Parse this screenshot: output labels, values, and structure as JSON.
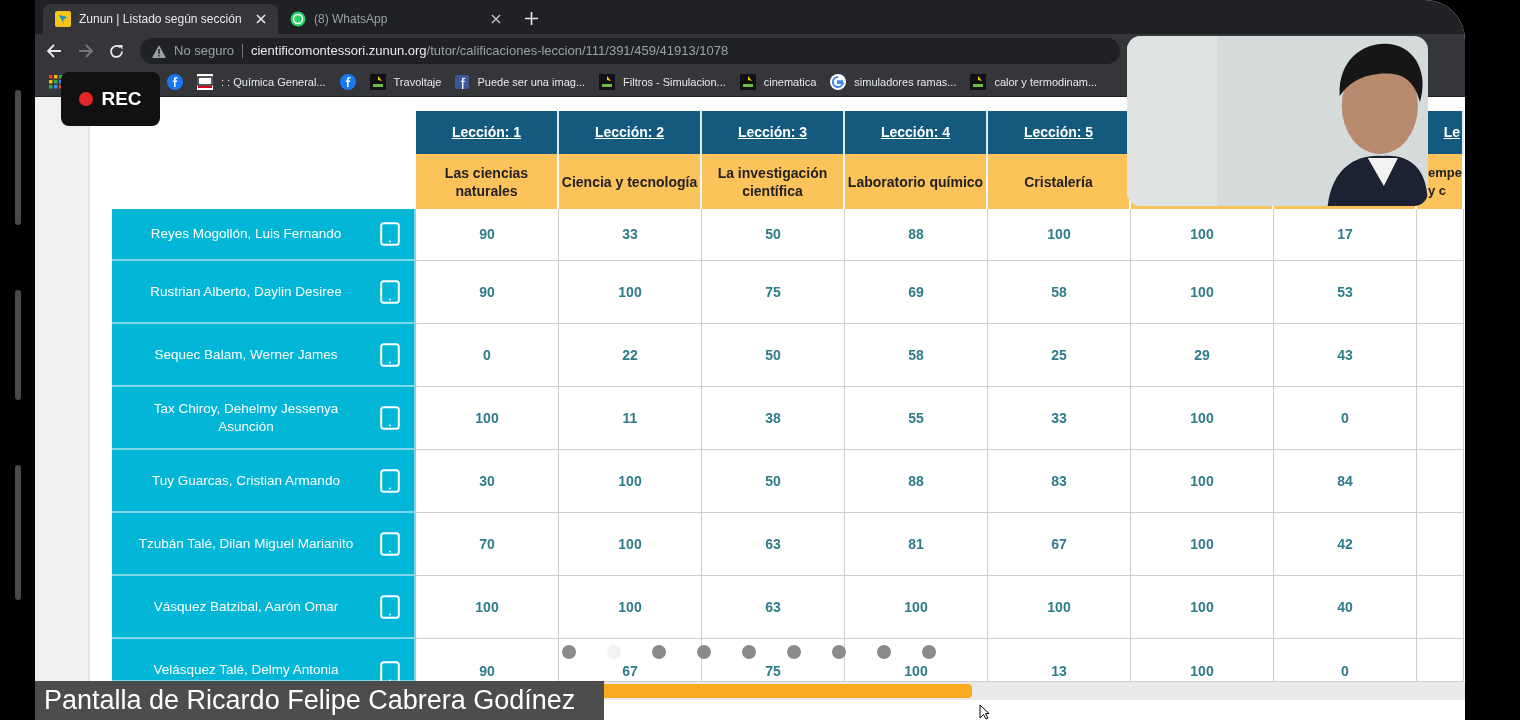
{
  "browser": {
    "tabs": [
      {
        "title": "Zunun | Listado según sección",
        "selected": true,
        "kind": "zunun"
      },
      {
        "title": "(8) WhatsApp",
        "selected": false,
        "kind": "whatsapp"
      }
    ],
    "security": "No seguro",
    "url_domain": "cientificomontessori.zunun.org",
    "url_path": "/tutor/calificaciones-leccion/111/391/459/41913/1078",
    "bookmarks": [
      {
        "kind": "apps"
      },
      {
        "kind": "facebook"
      },
      {
        "kind": "cg",
        "label": ": : Química General..."
      },
      {
        "kind": "facebook"
      },
      {
        "kind": "phet",
        "label": "Travoltaje"
      },
      {
        "kind": "fbsquare",
        "label": "Puede ser una imag..."
      },
      {
        "kind": "phet",
        "label": "Filtros - Simulacion..."
      },
      {
        "kind": "phet",
        "label": "cinematica"
      },
      {
        "kind": "google",
        "label": "simuladores ramas..."
      },
      {
        "kind": "phet",
        "label": "calor y termodinam..."
      }
    ]
  },
  "recording": {
    "label": "REC"
  },
  "table": {
    "columns": [
      {
        "lesson": "Lección: 1",
        "title": "Las ciencias naturales"
      },
      {
        "lesson": "Lección: 2",
        "title": "Ciencia y tecnología"
      },
      {
        "lesson": "Lección: 3",
        "title": "La investigación científica"
      },
      {
        "lesson": "Lección: 4",
        "title": "Laboratorio químico"
      },
      {
        "lesson": "Lección: 5",
        "title": "Cristalería"
      },
      {},
      {},
      {
        "lesson": "Le",
        "title": "empe\ny c"
      }
    ],
    "rows": [
      {
        "name": "Reyes Mogollón, Luis Fernando",
        "scores": [
          "90",
          "33",
          "50",
          "88",
          "100",
          "100",
          "17"
        ]
      },
      {
        "name": "Rustrian Alberto, Daylin Desiree",
        "scores": [
          "90",
          "100",
          "75",
          "69",
          "58",
          "100",
          "53"
        ]
      },
      {
        "name": "Sequec Balam, Werner James",
        "scores": [
          "0",
          "22",
          "50",
          "58",
          "25",
          "29",
          "43"
        ]
      },
      {
        "name": "Tax Chiroy, Dehelmy Jessenya Asunción",
        "scores": [
          "100",
          "11",
          "38",
          "55",
          "33",
          "100",
          "0"
        ]
      },
      {
        "name": "Tuy Guarcas, Cristian Armando",
        "scores": [
          "30",
          "100",
          "50",
          "88",
          "83",
          "100",
          "84"
        ]
      },
      {
        "name": "Tzubán Talé, Dilan Miguel Marianito",
        "scores": [
          "70",
          "100",
          "63",
          "81",
          "67",
          "100",
          "42"
        ]
      },
      {
        "name": "Vásquez Batzibal, Aarón Omar",
        "scores": [
          "100",
          "100",
          "63",
          "100",
          "100",
          "100",
          "40"
        ]
      },
      {
        "name": "Velásquez Talé, Delmy Antonia",
        "scores": [
          "90",
          "67",
          "75",
          "100",
          "13",
          "100",
          "0"
        ]
      }
    ]
  },
  "caption": "Pantalla de Ricardo Felipe Cabrera Godínez"
}
